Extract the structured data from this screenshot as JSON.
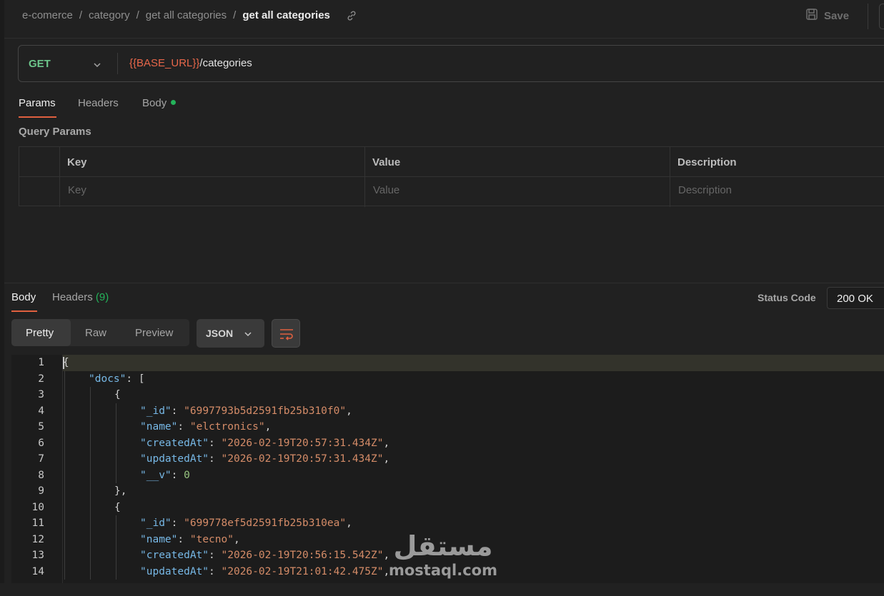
{
  "breadcrumb": {
    "items": [
      "e-comerce",
      "category",
      "get all categories"
    ],
    "current": "get all categories"
  },
  "toolbar": {
    "save_label": "Save"
  },
  "request": {
    "method": "GET",
    "url_variable": "{{BASE_URL}}",
    "url_path": "/categories",
    "tabs": {
      "params": "Params",
      "headers": "Headers",
      "body": "Body"
    },
    "active_tab": "Params"
  },
  "query_params": {
    "title": "Query Params",
    "headers": {
      "key": "Key",
      "value": "Value",
      "description": "Description"
    },
    "placeholders": {
      "key": "Key",
      "value": "Value",
      "description": "Description"
    }
  },
  "response": {
    "tabs": {
      "body": "Body",
      "headers": "Headers",
      "headers_count": "(9)"
    },
    "status_label": "Status Code",
    "status_value": "200 OK",
    "view_modes": {
      "pretty": "Pretty",
      "raw": "Raw",
      "preview": "Preview"
    },
    "active_view": "Pretty",
    "format": "JSON"
  },
  "code_lines": [
    {
      "n": "1",
      "indent": 0,
      "tokens": [
        [
          "p",
          "{"
        ]
      ]
    },
    {
      "n": "2",
      "indent": 1,
      "tokens": [
        [
          "k",
          "\"docs\""
        ],
        [
          "p",
          ": ["
        ]
      ]
    },
    {
      "n": "3",
      "indent": 2,
      "tokens": [
        [
          "p",
          "{"
        ]
      ]
    },
    {
      "n": "4",
      "indent": 3,
      "tokens": [
        [
          "k",
          "\"_id\""
        ],
        [
          "p",
          ": "
        ],
        [
          "s",
          "\"6997793b5d2591fb25b310f0\""
        ],
        [
          "p",
          ","
        ]
      ]
    },
    {
      "n": "5",
      "indent": 3,
      "tokens": [
        [
          "k",
          "\"name\""
        ],
        [
          "p",
          ": "
        ],
        [
          "s",
          "\"elctronics\""
        ],
        [
          "p",
          ","
        ]
      ]
    },
    {
      "n": "6",
      "indent": 3,
      "tokens": [
        [
          "k",
          "\"createdAt\""
        ],
        [
          "p",
          ": "
        ],
        [
          "s",
          "\"2026-02-19T20:57:31.434Z\""
        ],
        [
          "p",
          ","
        ]
      ]
    },
    {
      "n": "7",
      "indent": 3,
      "tokens": [
        [
          "k",
          "\"updatedAt\""
        ],
        [
          "p",
          ": "
        ],
        [
          "s",
          "\"2026-02-19T20:57:31.434Z\""
        ],
        [
          "p",
          ","
        ]
      ]
    },
    {
      "n": "8",
      "indent": 3,
      "tokens": [
        [
          "k",
          "\"__v\""
        ],
        [
          "p",
          ": "
        ],
        [
          "n",
          "0"
        ]
      ]
    },
    {
      "n": "9",
      "indent": 2,
      "tokens": [
        [
          "p",
          "},"
        ]
      ]
    },
    {
      "n": "10",
      "indent": 2,
      "tokens": [
        [
          "p",
          "{"
        ]
      ]
    },
    {
      "n": "11",
      "indent": 3,
      "tokens": [
        [
          "k",
          "\"_id\""
        ],
        [
          "p",
          ": "
        ],
        [
          "s",
          "\"699778ef5d2591fb25b310ea\""
        ],
        [
          "p",
          ","
        ]
      ]
    },
    {
      "n": "12",
      "indent": 3,
      "tokens": [
        [
          "k",
          "\"name\""
        ],
        [
          "p",
          ": "
        ],
        [
          "s",
          "\"tecno\""
        ],
        [
          "p",
          ","
        ]
      ]
    },
    {
      "n": "13",
      "indent": 3,
      "tokens": [
        [
          "k",
          "\"createdAt\""
        ],
        [
          "p",
          ": "
        ],
        [
          "s",
          "\"2026-02-19T20:56:15.542Z\""
        ],
        [
          "p",
          ","
        ]
      ]
    },
    {
      "n": "14",
      "indent": 3,
      "tokens": [
        [
          "k",
          "\"updatedAt\""
        ],
        [
          "p",
          ": "
        ],
        [
          "s",
          "\"2026-02-19T21:01:42.475Z\""
        ],
        [
          "p",
          ","
        ]
      ]
    }
  ],
  "watermark": {
    "arabic": "مستقل",
    "latin": "mostaql.com"
  },
  "icons": {
    "link": "link-icon",
    "save": "save-icon",
    "chevron": "chevron-down-icon",
    "wrap": "word-wrap-icon"
  },
  "colors": {
    "method": "#6cc48a",
    "url_variable": "#e8674a",
    "accent": "#e0603f",
    "indicator": "#24b35a",
    "json_key": "#77b8e6",
    "json_string": "#d58c68",
    "json_number": "#98c580"
  }
}
